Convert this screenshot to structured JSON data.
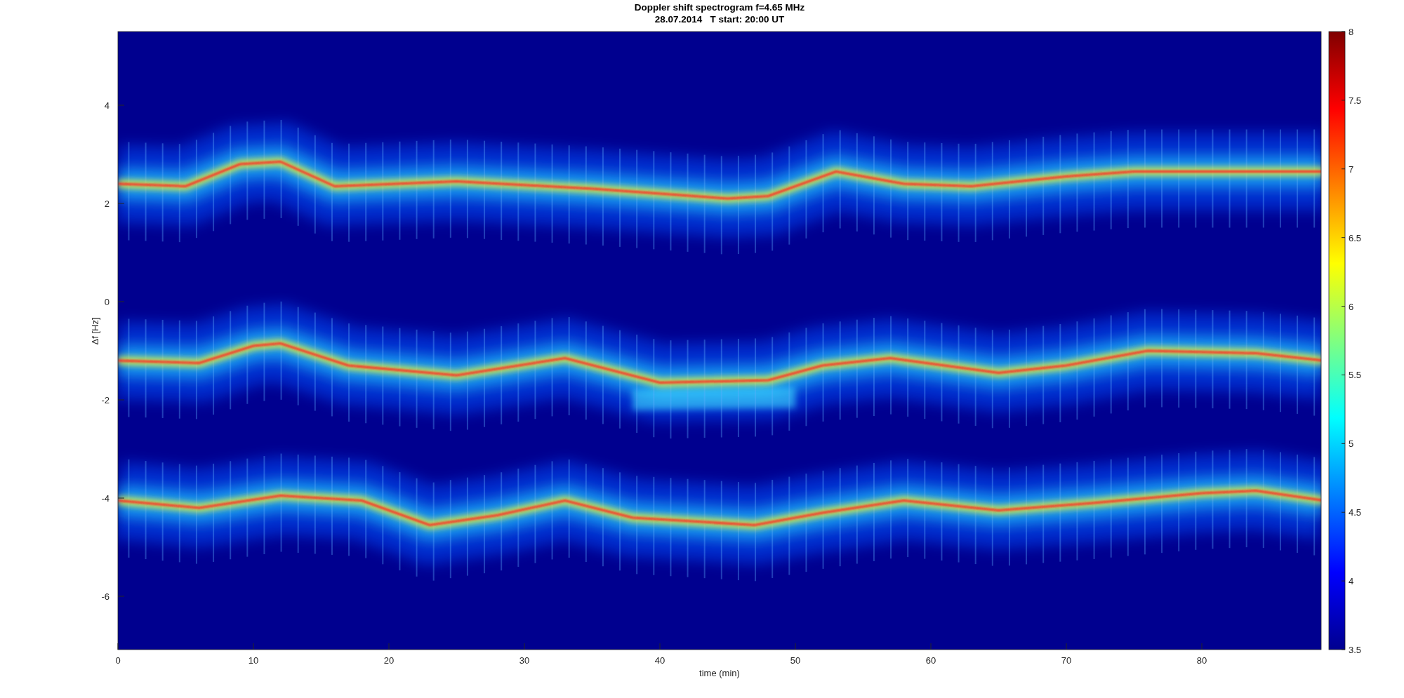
{
  "figure": {
    "title": [
      "Doppler shift spectrogram f=4.65 MHz",
      "28.07.2014   T start: 20:00 UT"
    ]
  },
  "axes": {
    "xlabel": "time (min)",
    "ylabel": "Δf [Hz]",
    "xticks": [
      "0",
      "10",
      "20",
      "30",
      "40",
      "50",
      "60",
      "70",
      "80"
    ],
    "yticks": [
      "4",
      "2",
      "0",
      "-2",
      "-4",
      "-6"
    ]
  },
  "colorbar": {
    "ticks": [
      "8",
      "7.5",
      "7",
      "6.5",
      "6",
      "5.5",
      "5",
      "4.5",
      "4",
      "3.5"
    ]
  }
}
